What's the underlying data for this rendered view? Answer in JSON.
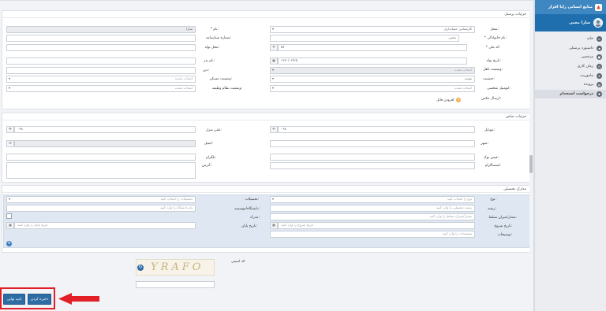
{
  "sidebar": {
    "brand": "منابع انسانی رایا افزار",
    "user_name": "سارا محبی",
    "items": [
      {
        "label": "خانه",
        "icon": "home-icon",
        "active": false
      },
      {
        "label": "داشبورد پرسنلی",
        "icon": "dashboard-icon",
        "active": false
      },
      {
        "label": "مرخصی",
        "icon": "leave-icon",
        "active": false
      },
      {
        "label": "زمان کاری",
        "icon": "clock-icon",
        "active": false
      },
      {
        "label": "ماموریت",
        "icon": "mission-icon",
        "active": false
      },
      {
        "label": "پرونده",
        "icon": "folder-icon",
        "active": false
      },
      {
        "label": "درخواست استخدام",
        "icon": "hire-request-icon",
        "active": true
      }
    ]
  },
  "personnel": {
    "title": "جزئیات پرسنل",
    "occupation_label": "شغل:",
    "occupation_value": "کارشناس حسابداری",
    "first_name_label": "* نام:",
    "first_name_value": "سارا",
    "last_name_label": "* نام خانوادگی:",
    "last_name_value": "محبی",
    "id_number_label": "شماره شناسنامه:",
    "national_code_label": "* کد ملی:",
    "national_code_value": "۵۷",
    "birth_place_label": "محل تولد:",
    "birth_date_label": "تاریخ تولد:",
    "birth_date_value": "۱۳۷۰/۰۳/۲۵",
    "father_name_label": "نام پدر:",
    "marital_label": "وضعیت تاهل:",
    "marital_placeholder": "انتخاب نشده",
    "religion_label": "دین:",
    "gender_label": "جنسیت:",
    "gender_value": "مونث",
    "housing_label": "وضعیت مسکن:",
    "housing_placeholder": "انتخاب نشده",
    "vehicle_label": "اتومبیل شخصی:",
    "vehicle_placeholder": "انتخاب نشده",
    "military_label": "وضعیت نظام وظیفه:",
    "military_placeholder": "انتخاب نشده",
    "photo_label": "ارسال عکس:",
    "upload_label": "افزودن فایل"
  },
  "contact": {
    "title": "جزئیات تماس",
    "mobile_label": "موبایل:",
    "mobile_prefix": "۰۹۸",
    "home_phone_label": "تلفن منزل:",
    "home_phone_prefix": "۰۹۸",
    "city_label": "شهر:",
    "email_label": "ایمیل:",
    "facebook_label": "فیس بوک:",
    "telegram_label": "تلگرام:",
    "instagram_label": "اینستاگرام:",
    "address_label": "آدرس:"
  },
  "education": {
    "title": "مدارک تحصیلی",
    "type_label": "نوع:",
    "type_placeholder": "نوع را انتخاب کنید",
    "degree_label": "تحصیلات:",
    "degree_placeholder": "تحصیلات را انتخاب کنید",
    "field_label": "رشته:",
    "field_placeholder": "رشته تحصیلی را وارد کنید",
    "university_label": "دانشگاه/موسسه:",
    "university_placeholder": "نام دانشگاه را وارد کنید",
    "gpa_label": "معدل/میزان تسلط:",
    "gpa_placeholder": "معدل/میزان تسلط را وارد کنید",
    "certificate_label": "مدرک:",
    "start_label": "تاریخ شروع:",
    "start_placeholder": "تاریخ شروع را وارد کنید",
    "end_label": "تاریخ پایان:",
    "end_placeholder": "تاریخ پایان را وارد کنید",
    "desc_label": "توضیحات:",
    "desc_placeholder": "توضیحات را وارد کنید",
    "add_button": "+"
  },
  "captcha": {
    "label": "کد امنیتی:",
    "text": "YRAFO",
    "refresh_icon": "refresh-icon"
  },
  "actions": {
    "save_label": "ذخیره کردن",
    "confirm_label": "تایید نهایی",
    "highlight_color": "#e21f26",
    "button_color": "#2e6da4"
  }
}
